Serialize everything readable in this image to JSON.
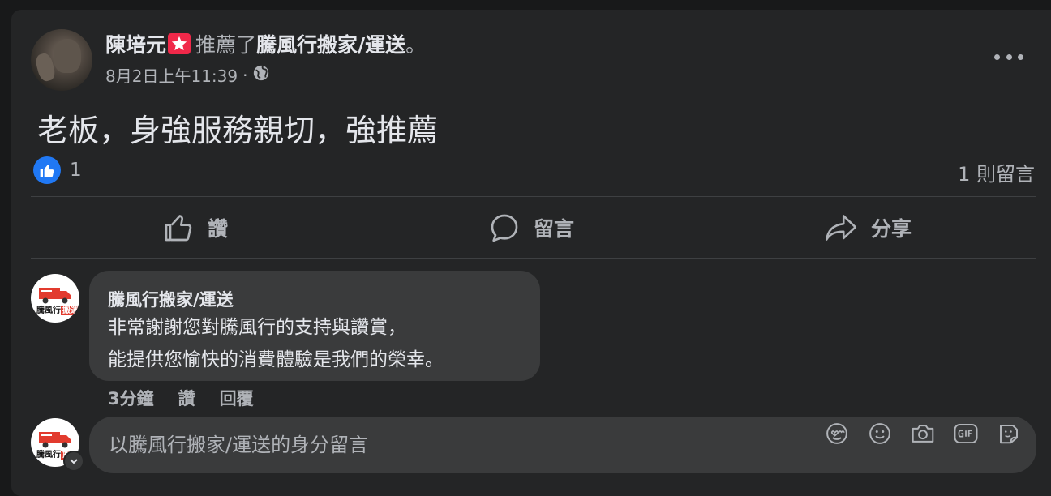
{
  "post": {
    "author": "陳培元",
    "verb": "推薦了",
    "page": "騰風行搬家/運送",
    "period": "。",
    "timestamp": "8月2日上午11:39",
    "dot": "·",
    "text": "老板，身強服務親切，強推薦",
    "like_count": "1",
    "comment_count": "1 則留言"
  },
  "actions": {
    "like": "讚",
    "comment": "留言",
    "share": "分享"
  },
  "comment": {
    "author": "騰風行搬家/運送",
    "line1": "非常謝謝您對騰風行的支持與讚賞，",
    "line2": "能提供您愉快的消費體驗是我們的榮幸。",
    "time": "3分鐘",
    "like": "讚",
    "reply": "回覆",
    "avatar_text": "騰風行",
    "avatar_tag": "搬運"
  },
  "reply": {
    "placeholder": "以騰風行搬家/運送的身分留言"
  },
  "icons": [
    "globe-icon",
    "more-icon",
    "thumbs-up-icon",
    "comment-icon",
    "share-icon",
    "avatar-icon",
    "sticker-icon",
    "emoji-icon",
    "camera-icon",
    "gif-icon",
    "chevron-down-icon"
  ],
  "colors": {
    "background": "#18191a",
    "card": "#242526",
    "bubble": "#3a3b3c",
    "like_blue": "#2078f4",
    "badge_red": "#f02849"
  }
}
